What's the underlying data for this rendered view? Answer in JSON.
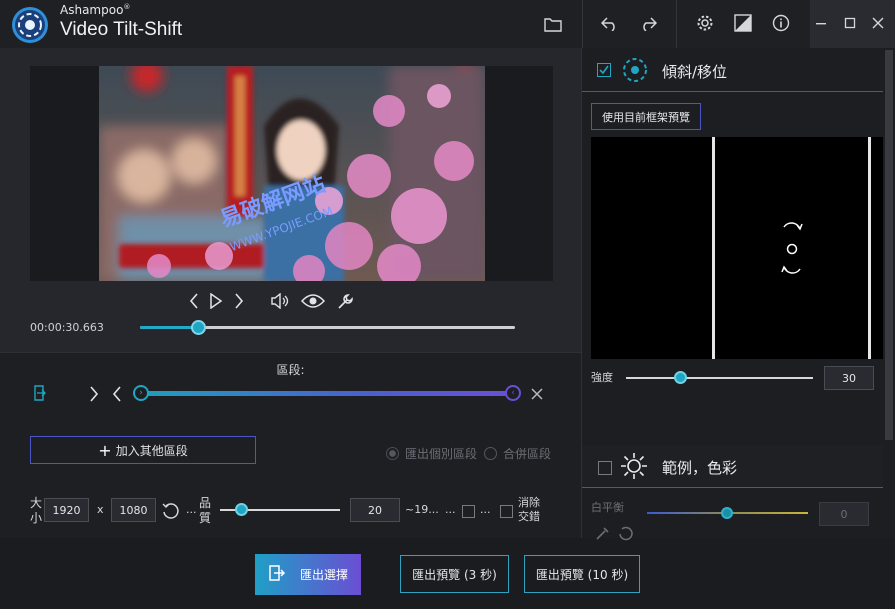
{
  "app": {
    "brand": "Ashampoo",
    "registered": "®",
    "name": "Video Tilt-Shift"
  },
  "toolbar": {
    "icons": [
      "folder-icon",
      "undo-icon",
      "redo-icon",
      "settings-icon",
      "split-view-icon",
      "info-icon"
    ],
    "window": [
      "minimize-icon",
      "maximize-icon",
      "close-icon"
    ]
  },
  "player": {
    "time": "00:00:30.663",
    "position_fraction": 0.16,
    "watermark_main": "易破解网站",
    "watermark_url": "WWW.YPOJIE.COM"
  },
  "segments": {
    "title": "區段:",
    "add_label": "加入其他區段",
    "export_each_label": "匯出個別區段",
    "merge_label": "合併區段"
  },
  "output": {
    "size_label": "大小",
    "width": "1920",
    "times": "x",
    "height": "1080",
    "ellipsis1": "...",
    "quality_label": "品質",
    "quality_value": "20",
    "approx": "~19...",
    "ellipsis2": "...",
    "deinterlace_label": "消除交錯"
  },
  "bottom": {
    "export_selection": "匯出選擇",
    "export_preview_3": "匯出預覽 (3 秒)",
    "export_preview_10": "匯出預覽 (10 秒)"
  },
  "tilt": {
    "checked": true,
    "title": "傾斜/移位",
    "use_frame_label": "使用目前框架預覽",
    "strength_label": "強度",
    "strength_value": "30",
    "strength_fraction": 0.29
  },
  "color": {
    "checked": false,
    "title": "範例，色彩",
    "white_balance_label": "白平衡",
    "white_balance_value": "0"
  },
  "colors": {
    "accent": "#1fa6c4",
    "accent2": "#4b56c4",
    "background": "#1c1d21"
  }
}
